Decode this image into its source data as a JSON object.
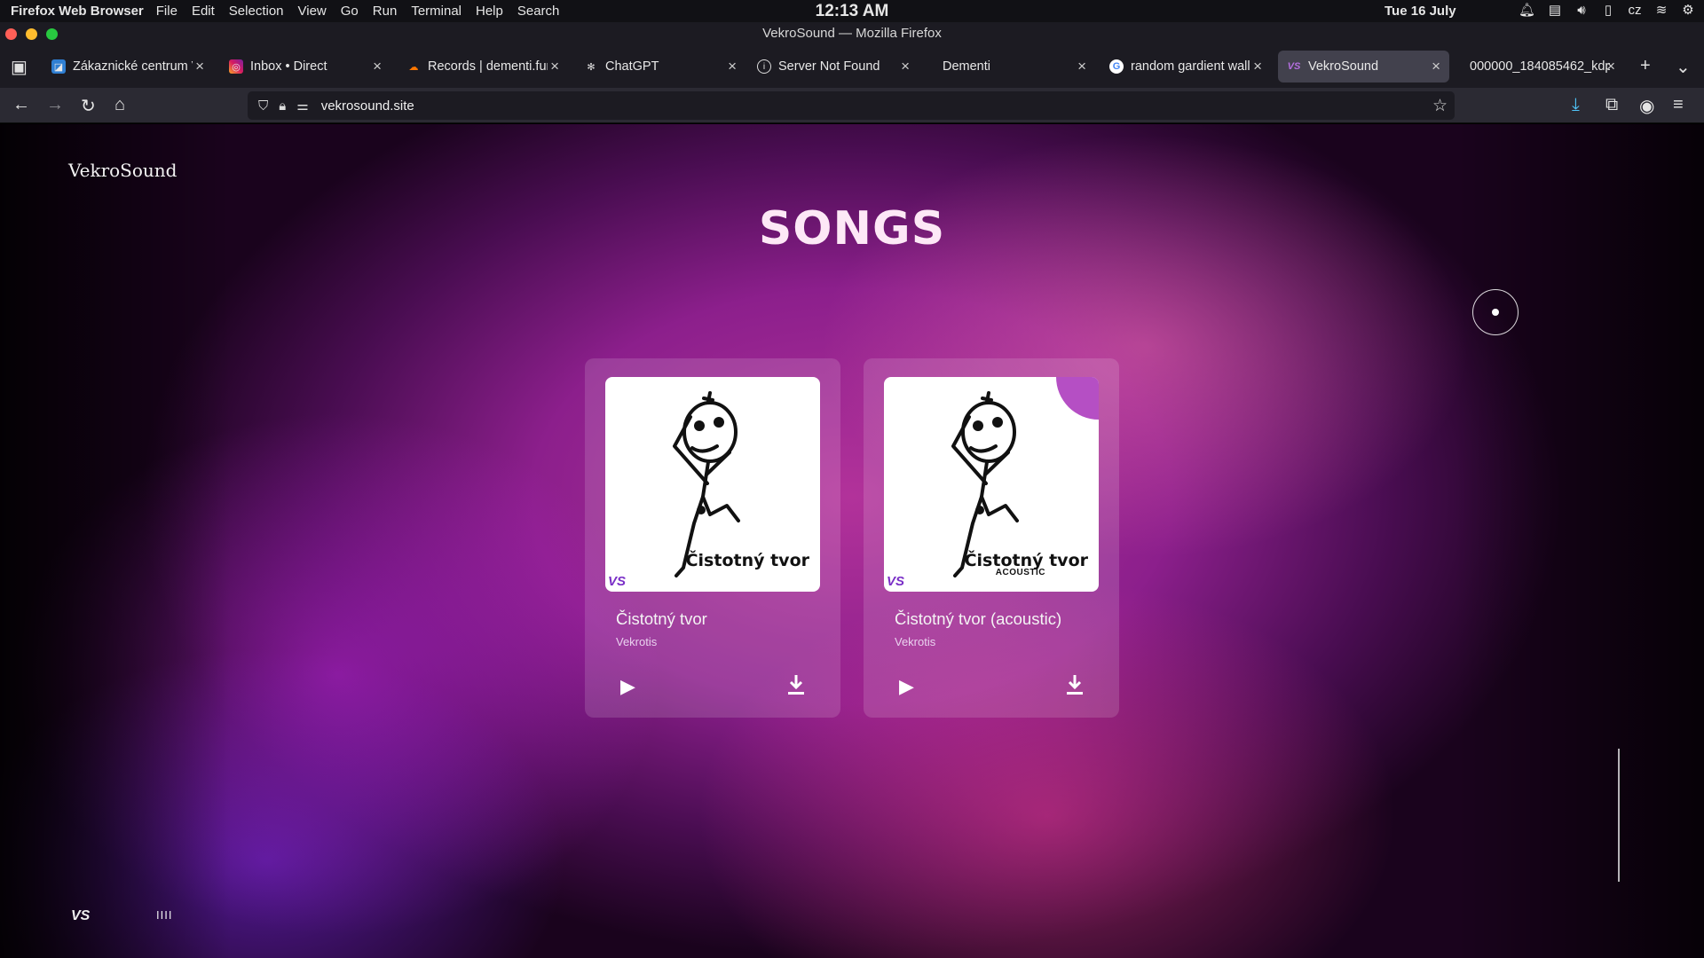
{
  "os": {
    "app_name": "Firefox Web Browser",
    "menu": [
      "File",
      "Edit",
      "Selection",
      "View",
      "Go",
      "Run",
      "Terminal",
      "Help",
      "Search"
    ],
    "clock": "12:13 AM",
    "date": "Tue 16 July",
    "keyboard_layout": "cz"
  },
  "window": {
    "title": "VekroSound — Mozilla Firefox",
    "traffic_light_colors": [
      "#ff5f57",
      "#febc2e",
      "#28c840"
    ]
  },
  "tabs": [
    {
      "title": "Zákaznické centrum V",
      "icon": "customer-center-favicon",
      "active": false
    },
    {
      "title": "Inbox • Direct",
      "icon": "instagram-favicon",
      "active": false
    },
    {
      "title": "Records | dementi.fun",
      "icon": "cloud-favicon",
      "active": false
    },
    {
      "title": "ChatGPT",
      "icon": "chatgpt-favicon",
      "active": false
    },
    {
      "title": "Server Not Found",
      "icon": "info-favicon",
      "active": false
    },
    {
      "title": "Dementi",
      "icon": "",
      "active": false
    },
    {
      "title": "random gardient wallp",
      "icon": "google-favicon",
      "active": false
    },
    {
      "title": "VekroSound",
      "icon": "vekrosound-favicon",
      "active": true
    },
    {
      "title": "000000_184085462_kdp",
      "icon": "",
      "active": false
    }
  ],
  "navbar": {
    "url": "vekrosound.site"
  },
  "page": {
    "brand": "VekroSound",
    "heading": "SONGS",
    "accent_colors": {
      "corner": "#b54fc4",
      "vs_logo": "#7a2fc7"
    },
    "songs": [
      {
        "title": "Čistotný tvor",
        "artist": "Vekrotis",
        "art_text": "Čistotný tvor",
        "art_subtext": "",
        "art_logo": "VS"
      },
      {
        "title": "Čistotný tvor (acoustic)",
        "artist": "Vekrotis",
        "art_text": "Čistotný tvor",
        "art_subtext": "ACOUSTIC",
        "art_logo": "VS"
      }
    ],
    "footer_logo": "VS",
    "footer_bars": "IIII"
  }
}
